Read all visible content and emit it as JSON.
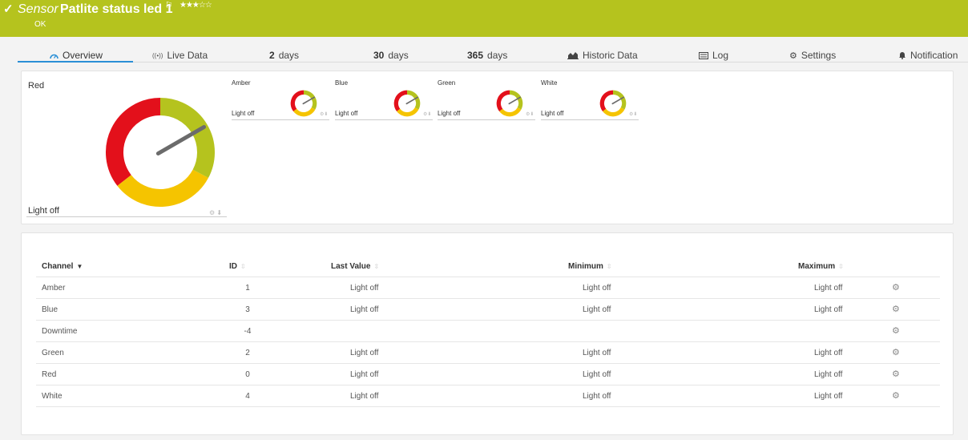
{
  "header": {
    "status_icon": "check-icon",
    "sensor_type": "Sensor",
    "sensor_name": "Patlite status led 1",
    "flag_icon": "flag-icon",
    "rating": 3,
    "rating_max": 5,
    "status": "OK"
  },
  "tabs": [
    {
      "icon": "gauge-icon",
      "label": "Overview"
    },
    {
      "icon": "live-data-icon",
      "label": "Live Data"
    },
    {
      "num": "2",
      "label": "days"
    },
    {
      "num": "30",
      "label": "days"
    },
    {
      "num": "365",
      "label": "days"
    },
    {
      "icon": "area-chart-icon",
      "label": "Historic Data"
    },
    {
      "icon": "log-icon",
      "label": "Log"
    },
    {
      "icon": "gear-icon",
      "label": "Settings"
    },
    {
      "icon": "bell-icon",
      "label": "Notification"
    }
  ],
  "gauges": {
    "primary": {
      "title": "Red",
      "value": "Light off"
    },
    "mini": [
      {
        "title": "Amber",
        "value": "Light off"
      },
      {
        "title": "Blue",
        "value": "Light off"
      },
      {
        "title": "Green",
        "value": "Light off"
      },
      {
        "title": "White",
        "value": "Light off"
      }
    ]
  },
  "colors": {
    "header": "#b5c31e",
    "gauge_red": "#e3101b",
    "gauge_yellow": "#f5c400",
    "gauge_green": "#b5c31e",
    "tab_active": "#2a8fd6"
  },
  "table": {
    "headers": {
      "channel": "Channel",
      "id": "ID",
      "last": "Last Value",
      "min": "Minimum",
      "max": "Maximum"
    },
    "rows": [
      {
        "channel": "Amber",
        "id": "1",
        "last": "Light off",
        "min": "Light off",
        "max": "Light off"
      },
      {
        "channel": "Blue",
        "id": "3",
        "last": "Light off",
        "min": "Light off",
        "max": "Light off"
      },
      {
        "channel": "Downtime",
        "id": "-4",
        "last": "",
        "min": "",
        "max": ""
      },
      {
        "channel": "Green",
        "id": "2",
        "last": "Light off",
        "min": "Light off",
        "max": "Light off"
      },
      {
        "channel": "Red",
        "id": "0",
        "last": "Light off",
        "min": "Light off",
        "max": "Light off"
      },
      {
        "channel": "White",
        "id": "4",
        "last": "Light off",
        "min": "Light off",
        "max": "Light off"
      }
    ]
  }
}
